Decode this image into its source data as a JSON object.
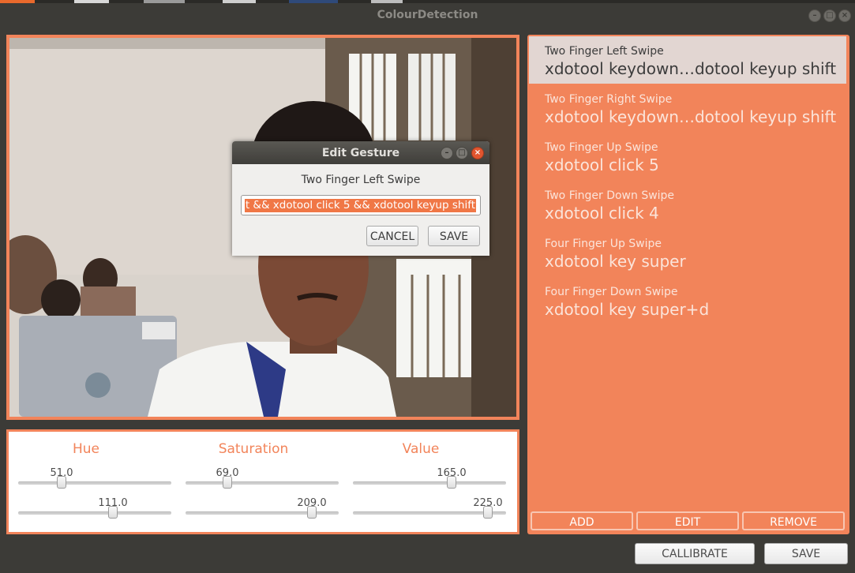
{
  "window": {
    "title": "ColourDetection"
  },
  "colors": {
    "accent": "#f2845a",
    "selection": "#f07746",
    "selected_item_bg": "#e2d6d2"
  },
  "sliders": [
    {
      "title": "Hue",
      "low": "51.0",
      "high": "111.0"
    },
    {
      "title": "Saturation",
      "low": "69.0",
      "high": "209.0"
    },
    {
      "title": "Value",
      "low": "165.0",
      "high": "225.0"
    }
  ],
  "gestures": [
    {
      "name": "Two Finger Left Swipe",
      "command": "xdotool keydown…dotool keyup shift",
      "selected": true
    },
    {
      "name": "Two Finger Right Swipe",
      "command": "xdotool keydown…dotool keyup shift"
    },
    {
      "name": "Two Finger Up Swipe",
      "command": "xdotool click 5"
    },
    {
      "name": "Two Finger Down Swipe",
      "command": "xdotool click 4"
    },
    {
      "name": "Four Finger Up Swipe",
      "command": "xdotool key super"
    },
    {
      "name": "Four Finger Down Swipe",
      "command": "xdotool key super+d"
    }
  ],
  "list_buttons": {
    "add": "ADD",
    "edit": "EDIT",
    "remove": "REMOVE"
  },
  "bottom_buttons": {
    "calibrate": "CALLIBRATE",
    "save": "SAVE"
  },
  "dialog": {
    "title": "Edit Gesture",
    "gesture_name": "Two Finger Left Swipe",
    "input_value": "t && xdotool click 5 && xdotool keyup shift",
    "cancel": "CANCEL",
    "save": "SAVE"
  }
}
